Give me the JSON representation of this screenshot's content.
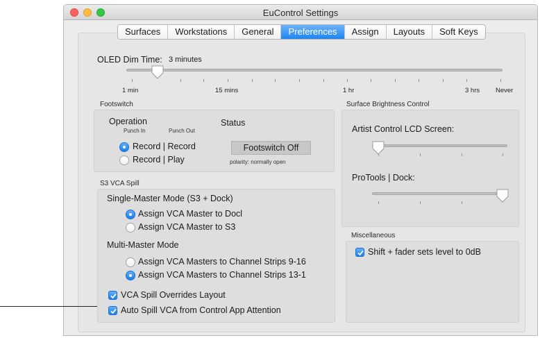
{
  "window": {
    "title": "EuControl Settings",
    "traffic_colors": {
      "close": "#fc615d",
      "minimize": "#fdbc40",
      "zoom": "#34c84a"
    }
  },
  "tabs": [
    {
      "label": "Surfaces",
      "active": false
    },
    {
      "label": "Workstations",
      "active": false
    },
    {
      "label": "General",
      "active": false
    },
    {
      "label": "Preferences",
      "active": true
    },
    {
      "label": "Assign",
      "active": false
    },
    {
      "label": "Layouts",
      "active": false
    },
    {
      "label": "Soft Keys",
      "active": false
    }
  ],
  "oled": {
    "label": "OLED Dim Time:",
    "value": "3 minutes",
    "tick_labels": [
      "1 min",
      "15 mins",
      "1 hr",
      "3 hrs",
      "Never"
    ]
  },
  "footswitch": {
    "title": "Footswitch",
    "operation_label": "Operation",
    "punch_in": "Punch In",
    "punch_out": "Punch Out",
    "options": [
      {
        "label": "Record | Record",
        "selected": true
      },
      {
        "label": "Record | Play",
        "selected": false
      }
    ],
    "status_label": "Status",
    "status_value": "Footswitch Off",
    "polarity": "polarity: normally open"
  },
  "brightness": {
    "title": "Surface Brightness Control",
    "artist_label": "Artist Control LCD Screen:",
    "dock_label": "ProTools | Dock:"
  },
  "vca_spill": {
    "title": "S3 VCA Spill",
    "single_label": "Single-Master Mode (S3 + Dock)",
    "single_options": [
      {
        "label": "Assign VCA Master to Docl",
        "selected": true
      },
      {
        "label": "Assign VCA Master to S3",
        "selected": false
      }
    ],
    "multi_label": "Multi-Master Mode",
    "multi_options": [
      {
        "label": "Assign VCA Masters to Channel Strips 9-16",
        "selected": false
      },
      {
        "label": "Assign VCA Masters to Channel Strips 13-1",
        "selected": true
      }
    ],
    "checks": [
      {
        "label": "VCA Spill Overrides Layout",
        "checked": true
      },
      {
        "label": "Auto Spill VCA from Control App Attention",
        "checked": true
      }
    ]
  },
  "misc": {
    "title": "Miscellaneous",
    "shift_label": "Shift + fader sets level to 0dB",
    "shift_checked": true
  }
}
